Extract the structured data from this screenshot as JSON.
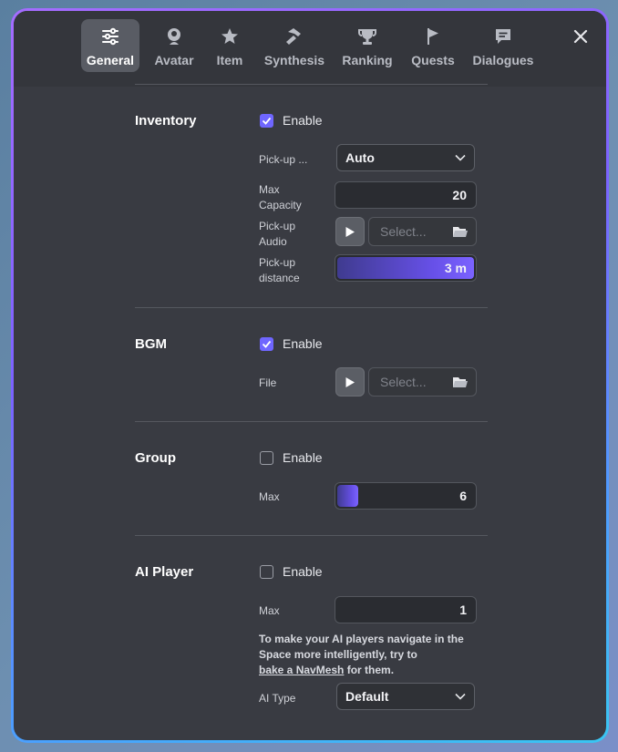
{
  "tabs": [
    {
      "label": "General",
      "icon": "sliders-icon"
    },
    {
      "label": "Avatar",
      "icon": "avatar-icon"
    },
    {
      "label": "Item",
      "icon": "item-icon"
    },
    {
      "label": "Synthesis",
      "icon": "hammer-icon"
    },
    {
      "label": "Ranking",
      "icon": "trophy-icon"
    },
    {
      "label": "Quests",
      "icon": "flag-icon"
    },
    {
      "label": "Dialogues",
      "icon": "chat-icon"
    }
  ],
  "active_tab": "General",
  "inventory": {
    "title": "Inventory",
    "enable_label": "Enable",
    "enabled": true,
    "pickup_mode_label": "Pick-up ...",
    "pickup_mode_value": "Auto",
    "max_capacity_label_1": "Max",
    "max_capacity_label_2": "Capacity",
    "max_capacity_value": "20",
    "pickup_audio_label_1": "Pick-up",
    "pickup_audio_label_2": "Audio",
    "pickup_audio_placeholder": "Select...",
    "pickup_distance_label_1": "Pick-up",
    "pickup_distance_label_2": "distance",
    "pickup_distance_value": "3 m",
    "pickup_distance_fill": 1.0
  },
  "bgm": {
    "title": "BGM",
    "enable_label": "Enable",
    "enabled": true,
    "file_label": "File",
    "file_placeholder": "Select..."
  },
  "group": {
    "title": "Group",
    "enable_label": "Enable",
    "enabled": false,
    "max_label": "Max",
    "max_value": "6",
    "max_fill": 0.15
  },
  "ai_player": {
    "title": "AI Player",
    "enable_label": "Enable",
    "enabled": false,
    "max_label": "Max",
    "max_value": "1",
    "hint_line1": "To make your AI players navigate in the",
    "hint_line2": "Space more intelligently, try to",
    "hint_link": "bake a NavMesh",
    "hint_tail": " for them.",
    "ai_type_label": "AI Type",
    "ai_type_value": "Default"
  },
  "colors": {
    "accent": "#6f66ff",
    "panel": "#393b42",
    "border_gradient_start": "#a56cff",
    "border_gradient_end": "#39c6f2"
  }
}
